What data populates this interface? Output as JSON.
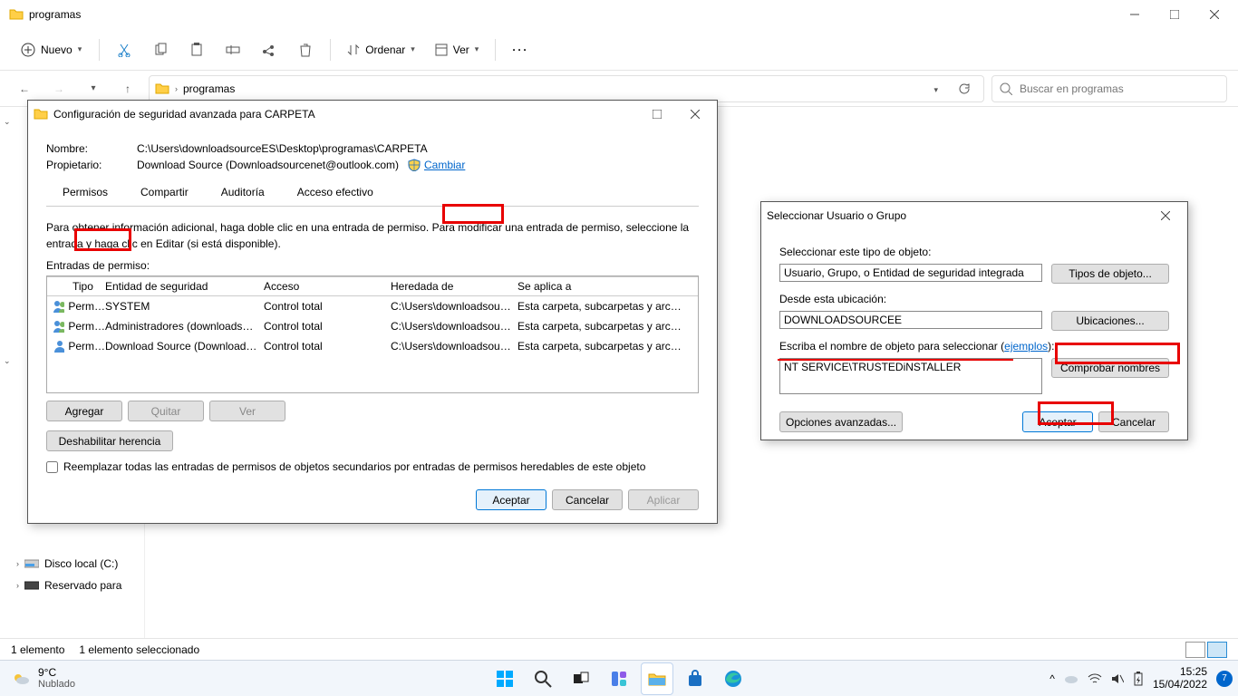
{
  "explorer": {
    "title": "programas",
    "new_label": "Nuevo",
    "sort_label": "Ordenar",
    "view_label": "Ver",
    "address": {
      "root": "",
      "crumb": "programas",
      "down": "▾"
    },
    "search_placeholder": "Buscar en programas",
    "nav": {
      "disk": "Disco local (C:)",
      "reserved": "Reservado para"
    },
    "status": {
      "count": "1 elemento",
      "selected": "1 elemento seleccionado"
    }
  },
  "adv": {
    "title": "Configuración de seguridad avanzada para CARPETA",
    "name_lbl": "Nombre:",
    "name_val": "C:\\Users\\downloadsourceES\\Desktop\\programas\\CARPETA",
    "owner_lbl": "Propietario:",
    "owner_val": "Download Source (Downloadsourcenet@outlook.com)",
    "change": "Cambiar",
    "tabs": {
      "permisos": "Permisos",
      "compartir": "Compartir",
      "auditoria": "Auditoría",
      "acceso": "Acceso efectivo"
    },
    "help": "Para obtener información adicional, haga doble clic en una entrada de permiso. Para modificar una entrada de permiso, seleccione la entrada y haga clic en Editar (si está disponible).",
    "entries_lbl": "Entradas de permiso:",
    "cols": {
      "tipo": "Tipo",
      "entidad": "Entidad de seguridad",
      "acceso": "Acceso",
      "heredada": "Heredada de",
      "aplica": "Se aplica a"
    },
    "rows": [
      {
        "tipo": "Perm…",
        "entidad": "SYSTEM",
        "acceso": "Control total",
        "heredada": "C:\\Users\\downloadsou…",
        "aplica": "Esta carpeta, subcarpetas y arc…"
      },
      {
        "tipo": "Perm…",
        "entidad": "Administradores (downloads…",
        "acceso": "Control total",
        "heredada": "C:\\Users\\downloadsou…",
        "aplica": "Esta carpeta, subcarpetas y arc…"
      },
      {
        "tipo": "Perm…",
        "entidad": "Download Source (Download…",
        "acceso": "Control total",
        "heredada": "C:\\Users\\downloadsou…",
        "aplica": "Esta carpeta, subcarpetas y arc…"
      }
    ],
    "add": "Agregar",
    "remove": "Quitar",
    "view": "Ver",
    "disable_inh": "Deshabilitar herencia",
    "replace_chk": "Reemplazar todas las entradas de permisos de objetos secundarios por entradas de permisos heredables de este objeto",
    "ok": "Aceptar",
    "cancel": "Cancelar",
    "apply": "Aplicar"
  },
  "selusr": {
    "title": "Seleccionar Usuario o Grupo",
    "objtype_lbl": "Seleccionar este tipo de objeto:",
    "objtype_val": "Usuario, Grupo, o Entidad de seguridad integrada",
    "objtype_btn": "Tipos de objeto...",
    "loc_lbl": "Desde esta ubicación:",
    "loc_val": "DOWNLOADSOURCEE",
    "loc_btn": "Ubicaciones...",
    "name_lbl_pre": "Escriba el nombre de objeto para seleccionar (",
    "name_lbl_link": "ejemplos",
    "name_lbl_post": "):",
    "name_val": "NT SERVICE\\TRUSTEDiNSTALLER",
    "check_btn": "Comprobar nombres",
    "advanced": "Opciones avanzadas...",
    "ok": "Aceptar",
    "cancel": "Cancelar"
  },
  "taskbar": {
    "weather_temp": "9°C",
    "weather_desc": "Nublado",
    "time": "15:25",
    "date": "15/04/2022",
    "notif": "7"
  }
}
